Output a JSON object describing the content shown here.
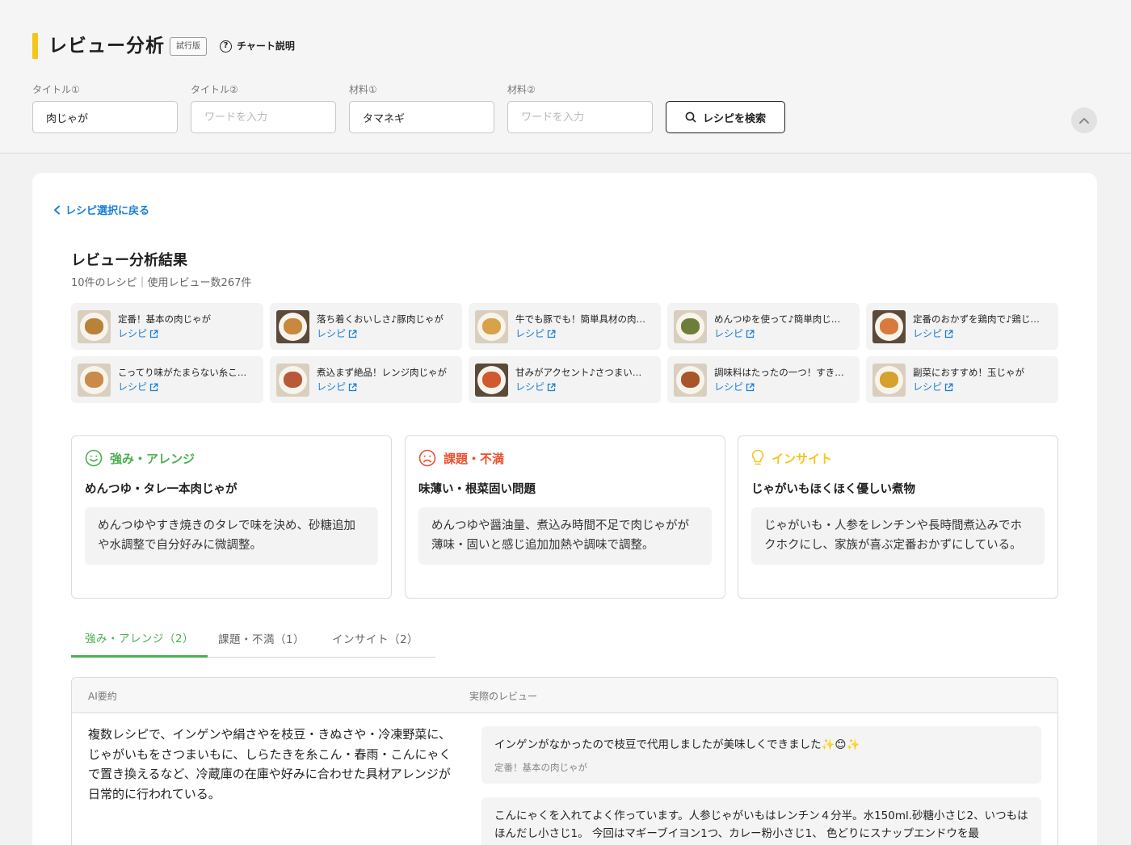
{
  "header": {
    "title": "レビュー分析",
    "badge": "試行版",
    "chart_help": "チャート説明",
    "accent_color": "#f5c51b"
  },
  "search": {
    "fields": [
      {
        "label": "タイトル①",
        "value": "肉じゃが",
        "placeholder": "ワードを入力"
      },
      {
        "label": "タイトル②",
        "value": "",
        "placeholder": "ワードを入力"
      },
      {
        "label": "材料①",
        "value": "タマネギ",
        "placeholder": "ワードを入力"
      },
      {
        "label": "材料②",
        "value": "",
        "placeholder": "ワードを入力"
      }
    ],
    "button_label": "レシピを検索",
    "button_icon": "search-icon",
    "collapse_icon": "chevron-up-icon"
  },
  "main": {
    "back_link": "レシピ選択に戻る",
    "result_title": "レビュー分析結果",
    "result_sub": "10件のレシピ｜使用レビュー数267件",
    "link_color": "#1a7fd6",
    "recipes": [
      {
        "name": "定番！基本の肉じゃが",
        "link": "レシピ"
      },
      {
        "name": "落ち着くおいしさ♪豚肉じゃが",
        "link": "レシピ"
      },
      {
        "name": "牛でも豚でも！簡単具材の肉…",
        "link": "レシピ"
      },
      {
        "name": "めんつゆを使って♪簡単肉じ…",
        "link": "レシピ"
      },
      {
        "name": "定番のおかずを鶏肉で♪鶏じ…",
        "link": "レシピ"
      },
      {
        "name": "こってり味がたまらない糸こ…",
        "link": "レシピ"
      },
      {
        "name": "煮込まず絶品！レンジ肉じゃが",
        "link": "レシピ"
      },
      {
        "name": "甘みがアクセント♪さつまい…",
        "link": "レシピ"
      },
      {
        "name": "調味料はたったの一つ！すき…",
        "link": "レシピ"
      },
      {
        "name": "副菜におすすめ！玉じゃが",
        "link": "レシピ"
      }
    ],
    "insights": [
      {
        "heading": "強み・アレンジ",
        "icon": "smile-icon",
        "color": "#4caf50",
        "title": "めんつゆ・タレ一本肉じゃが",
        "body": "めんつゆやすき焼きのタレで味を決め、砂糖追加や水調整で自分好みに微調整。"
      },
      {
        "heading": "課題・不満",
        "icon": "frown-icon",
        "color": "#e8522e",
        "title": "味薄い・根菜固い問題",
        "body": "めんつゆや醤油量、煮込み時間不足で肉じゃがが薄味・固いと感じ追加加熱や調味で調整。"
      },
      {
        "heading": "インサイト",
        "icon": "lightbulb-icon",
        "color": "#f5c51b",
        "title": "じゃがいもほくほく優しい煮物",
        "body": "じゃがいも・人参をレンチンや長時間煮込みでホクホクにし、家族が喜ぶ定番おかずにしている。"
      }
    ],
    "tabs": [
      {
        "label": "強み・アレンジ（2）",
        "active": true
      },
      {
        "label": "課題・不満（1）",
        "active": false
      },
      {
        "label": "インサイト（2）",
        "active": false
      }
    ],
    "table": {
      "col_ai": "AI要約",
      "col_review": "実際のレビュー",
      "ai_summary": "複数レシピで、インゲンや絹さやを枝豆・きぬさや・冷凍野菜に、じゃがいもをさつまいもに、しらたきを糸こん・春雨・こんにゃくで置き換えるなど、冷蔵庫の在庫や好みに合わせた具材アレンジが日常的に行われている。",
      "reviews": [
        {
          "text": "インゲンがなかったので枝豆で代用しましたが美味しくできました✨😊✨",
          "source": "定番！基本の肉じゃが"
        },
        {
          "text": "こんにゃくを入れてよく作っています。人参じゃがいもはレンチン４分半。水150ml.砂糖小さじ2、いつもはほんだし小さじ1。 今回はマギーブイヨン1つ、カレー粉小さじ1、 色どりにスナップエンドウを最",
          "source": ""
        }
      ]
    }
  }
}
